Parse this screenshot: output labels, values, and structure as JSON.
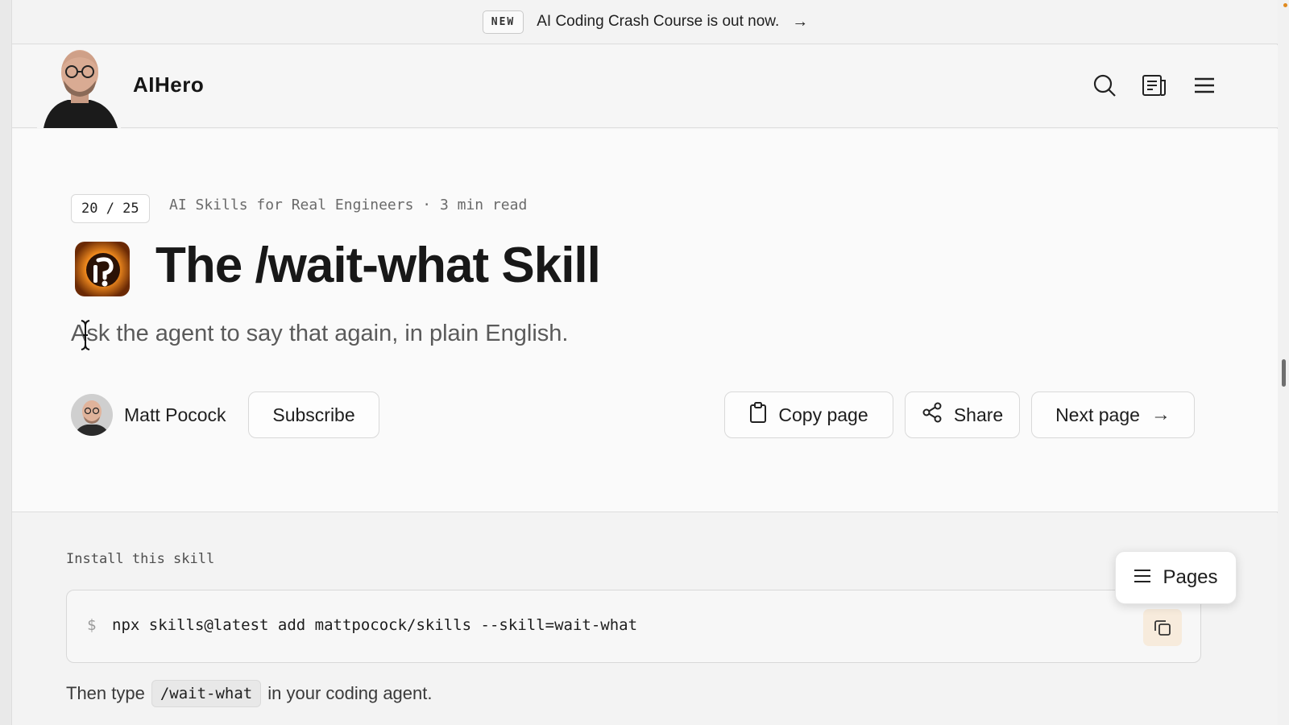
{
  "announcement": {
    "badge": "NEW",
    "text": "AI Coding Crash Course is out now."
  },
  "header": {
    "brand": "AIHero",
    "icons": [
      "search-icon",
      "reader-icon",
      "menu-icon"
    ]
  },
  "article": {
    "step": "20 / 25",
    "course_meta": "AI Skills for Real Engineers · 3 min read",
    "title": "The /wait-what Skill",
    "subtitle": "Ask the agent to say that again, in plain English.",
    "author": "Matt Pocock",
    "subscribe_label": "Subscribe",
    "copy_label": "Copy page",
    "share_label": "Share",
    "next_label": "Next page"
  },
  "install": {
    "label": "Install this skill",
    "prompt": "$",
    "command": "npx skills@latest add mattpocock/skills --skill=wait-what",
    "then_prefix": "Then type",
    "then_code": "/wait-what",
    "then_suffix": "in your coding agent."
  },
  "pages_button": {
    "label": "Pages"
  },
  "colors": {
    "accent_orange": "#f0a13a",
    "background": "#f4f4f4",
    "text": "#1d1d1d"
  }
}
